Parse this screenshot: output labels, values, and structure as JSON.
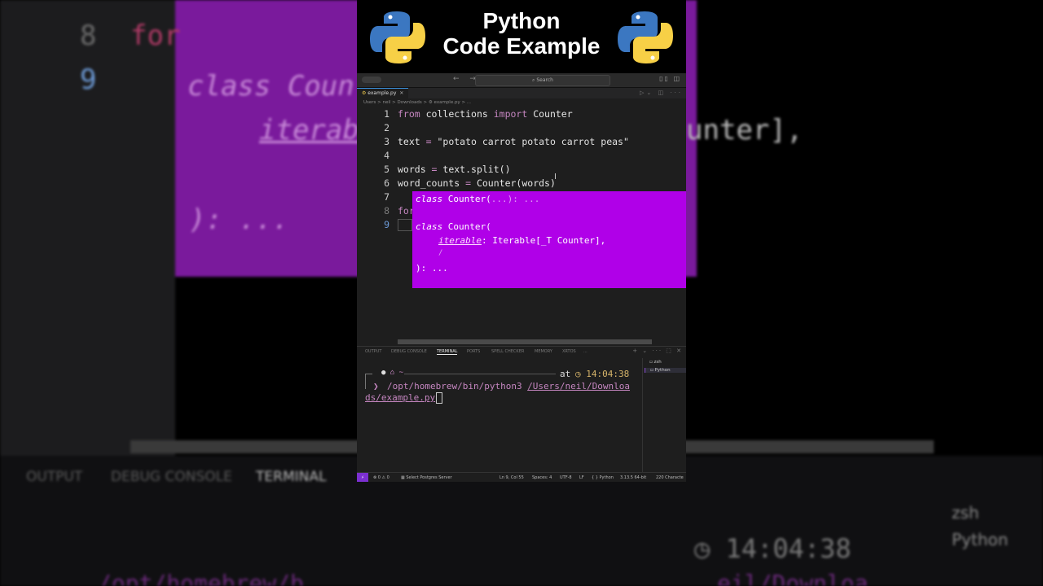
{
  "banner": {
    "line1": "Python",
    "line2": "Code Example"
  },
  "window": {
    "search_placeholder": "⌕ Search"
  },
  "tab": {
    "label": "example.py",
    "close": "✕"
  },
  "breadcrumb": "Users > neil > Downloads > ⚙ example.py > ...",
  "code_lines": [
    {
      "num": "1",
      "tokens": [
        {
          "t": "from",
          "c": "kw"
        },
        {
          "t": " collections ",
          "c": ""
        },
        {
          "t": "import",
          "c": "kw"
        },
        {
          "t": " Counter",
          "c": ""
        }
      ]
    },
    {
      "num": "2",
      "tokens": []
    },
    {
      "num": "3",
      "tokens": [
        {
          "t": "text ",
          "c": ""
        },
        {
          "t": "=",
          "c": "op"
        },
        {
          "t": " \"potato carrot potato carrot peas\"",
          "c": "str"
        }
      ]
    },
    {
      "num": "4",
      "tokens": []
    },
    {
      "num": "5",
      "tokens": [
        {
          "t": "words ",
          "c": ""
        },
        {
          "t": "=",
          "c": "op"
        },
        {
          "t": " text.split()",
          "c": ""
        }
      ]
    },
    {
      "num": "6",
      "tokens": [
        {
          "t": "word_counts ",
          "c": ""
        },
        {
          "t": "=",
          "c": "op"
        },
        {
          "t": " Counter(words)",
          "c": ""
        }
      ]
    },
    {
      "num": "7",
      "tokens": []
    },
    {
      "num": "8",
      "tokens": [
        {
          "t": "for",
          "c": "kw"
        }
      ]
    },
    {
      "num": "9",
      "tokens": []
    }
  ],
  "hover": {
    "line1_kw": "class",
    "line1_rest": " Counter(",
    "line1_dim": "...): ...",
    "line2_kw": "class",
    "line2_rest": " Counter(",
    "line3_param": "iterable",
    "line3_rest": ": Iterable[_T Counter],",
    "line4": "/",
    "line5": "): ..."
  },
  "panel_tabs": [
    "OUTPUT",
    "DEBUG CONSOLE",
    "TERMINAL",
    "PORTS",
    "SPELL CHECKER",
    "MEMORY",
    "XRTOS",
    "..."
  ],
  "panel_tab_actions": "+ ⌄ ··· ⬚ ✕",
  "terminal": {
    "prompt_icons": "  ⌂ ~",
    "at_label": "at",
    "time": "◷ 14:04:38",
    "arrow": "❯",
    "cmd": "/opt/homebrew/bin/python3 ",
    "path_part1": "/Users/neil/Downloa",
    "path_part2": "ds/example.py"
  },
  "terminal_list": [
    "zsh",
    "Python"
  ],
  "status_bar": {
    "remote": "⚡",
    "problems": "⊗ 0 ⚠ 0",
    "db": "Select Postgres Server",
    "position": "Ln 9, Col 55",
    "spaces": "Spaces: 4",
    "encoding": "UTF-8",
    "eol": "LF",
    "language": "{ } Python",
    "interpreter": "3.13.5 64-bit",
    "chars": "220 Characte"
  },
  "background": {
    "line8_num": "8",
    "line9_num": "9",
    "line8_kw": "for",
    "bg_class": "class Coun",
    "bg_iterable": "iterab",
    "bg_unter": "unter],",
    "bg_tail": "): ...",
    "bg_tabs": [
      "OUTPUT",
      "DEBUG CONSOLE",
      "TERMINAL"
    ],
    "bg_terms": [
      "zsh",
      "Python"
    ],
    "bg_time": "◷ 14:04:38",
    "bg_path": "/opt/homebrew/b",
    "bg_path2": "eil/Downloa"
  },
  "colors": {
    "hover_bg": "#b000e8",
    "accent": "#7b2fd0",
    "keyword": "#c586c0"
  },
  "icons": [
    "python-logo-icon",
    "search-icon",
    "close-icon",
    "apple-icon",
    "home-icon",
    "clock-icon"
  ]
}
